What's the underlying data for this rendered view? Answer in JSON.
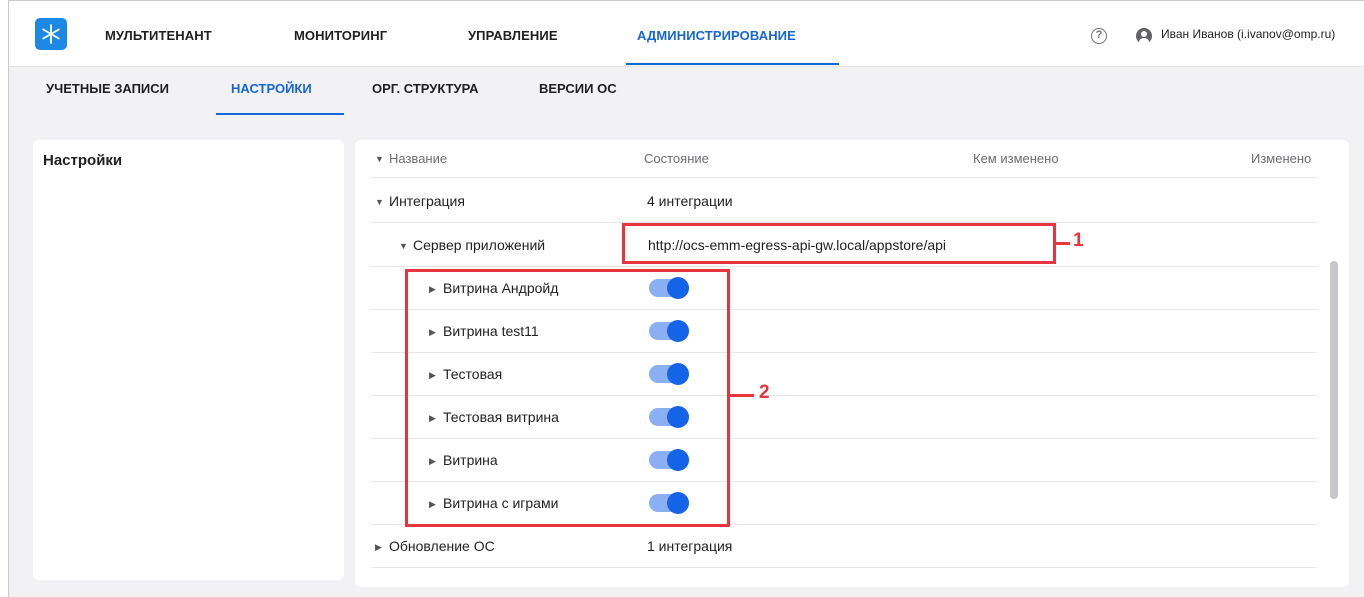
{
  "topnav": {
    "items": [
      {
        "label": "МУЛЬТИТЕНАНТ"
      },
      {
        "label": "МОНИТОРИНГ"
      },
      {
        "label": "УПРАВЛЕНИЕ"
      },
      {
        "label": "АДМИНИСТРИРОВАНИЕ",
        "active": true
      }
    ],
    "help_glyph": "?",
    "user": "Иван Иванов (i.ivanov@omp.ru)"
  },
  "subnav": {
    "items": [
      {
        "label": "УЧЕТНЫЕ ЗАПИСИ"
      },
      {
        "label": "НАСТРОЙКИ",
        "active": true
      },
      {
        "label": "ОРГ. СТРУКТУРА"
      },
      {
        "label": "ВЕРСИИ ОС"
      }
    ]
  },
  "sidebar": {
    "title": "Настройки"
  },
  "table": {
    "headers": {
      "name": "Название",
      "state": "Состояние",
      "changed_by": "Кем изменено",
      "changed": "Изменено"
    },
    "rows": [
      {
        "name": "Интеграция",
        "state": "4 интеграции",
        "level": 0,
        "expanded": true
      },
      {
        "name": "Сервер приложений",
        "state": "http://ocs-emm-egress-api-gw.local/appstore/api",
        "level": 1,
        "expanded": true
      },
      {
        "name": "Витрина Андройд",
        "toggle": true,
        "level": 2,
        "expanded": false
      },
      {
        "name": "Витрина test11",
        "toggle": true,
        "level": 2,
        "expanded": false
      },
      {
        "name": "Тестовая",
        "toggle": true,
        "level": 2,
        "expanded": false
      },
      {
        "name": "Тестовая витрина",
        "toggle": true,
        "level": 2,
        "expanded": false
      },
      {
        "name": "Витрина",
        "toggle": true,
        "level": 2,
        "expanded": false
      },
      {
        "name": "Витрина с играми",
        "toggle": true,
        "level": 2,
        "expanded": false
      },
      {
        "name": "Обновление ОС",
        "state": "1 интеграция",
        "level": 0,
        "expanded": false
      }
    ]
  },
  "annotations": {
    "label_1": "1",
    "label_2": "2"
  },
  "colors": {
    "accent": "#1565d8",
    "annotation": "#e7343f",
    "toggle_on": "#1564e8"
  },
  "icons": {
    "logo": "snowflake-logo-icon",
    "help": "help-circle-icon",
    "user": "user-account-icon",
    "caret_down": "caret-down-icon",
    "caret_right": "caret-right-icon"
  }
}
